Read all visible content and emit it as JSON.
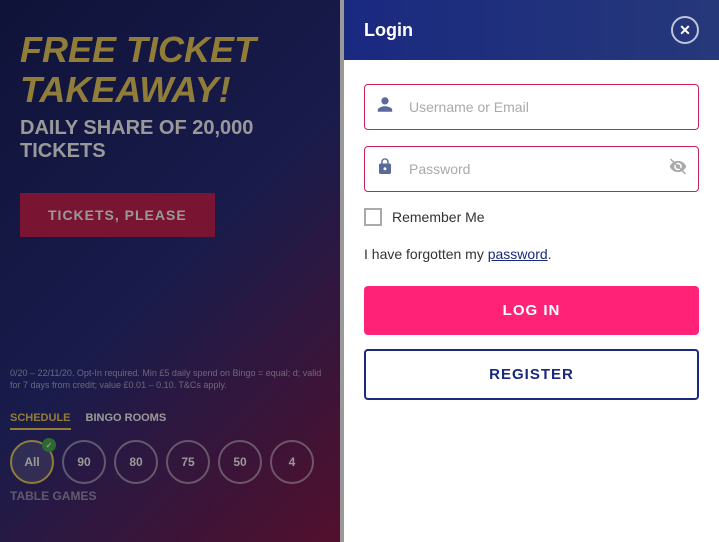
{
  "background": {
    "promo_title": "FREE TICKET TAKEAWAY!",
    "promo_subtitle": "DAILY SHARE OF 20,000 TICKETS",
    "tickets_btn_label": "TICKETS, PLEASE",
    "small_print": "0/20 – 22/11/20. Opt-In required. Min £5 daily spend on Bingo = equal; d; valid for 7 days from credit; value £0.01 – 0.10. T&Cs apply.",
    "nav_tab_schedule": "SCHEDULE",
    "nav_tab_bingo_rooms": "BINGO ROOMS",
    "circles": [
      {
        "label": "All",
        "active": true,
        "check": true
      },
      {
        "label": "90",
        "active": false,
        "check": false
      },
      {
        "label": "80",
        "active": false,
        "check": false
      },
      {
        "label": "75",
        "active": false,
        "check": false
      },
      {
        "label": "50",
        "active": false,
        "check": false
      },
      {
        "label": "4",
        "active": false,
        "check": false
      }
    ],
    "table_games_label": "Table Games"
  },
  "modal": {
    "title": "Login",
    "close_icon": "✕",
    "username_placeholder": "Username or Email",
    "username_icon": "👤",
    "password_placeholder": "Password",
    "password_icon": "🔒",
    "eye_icon": "👁",
    "remember_label": "Remember Me",
    "forgot_text": "I have forgotten my ",
    "forgot_link_text": "password",
    "forgot_period": ".",
    "login_btn_label": "LOG IN",
    "register_btn_label": "REGISTER"
  }
}
